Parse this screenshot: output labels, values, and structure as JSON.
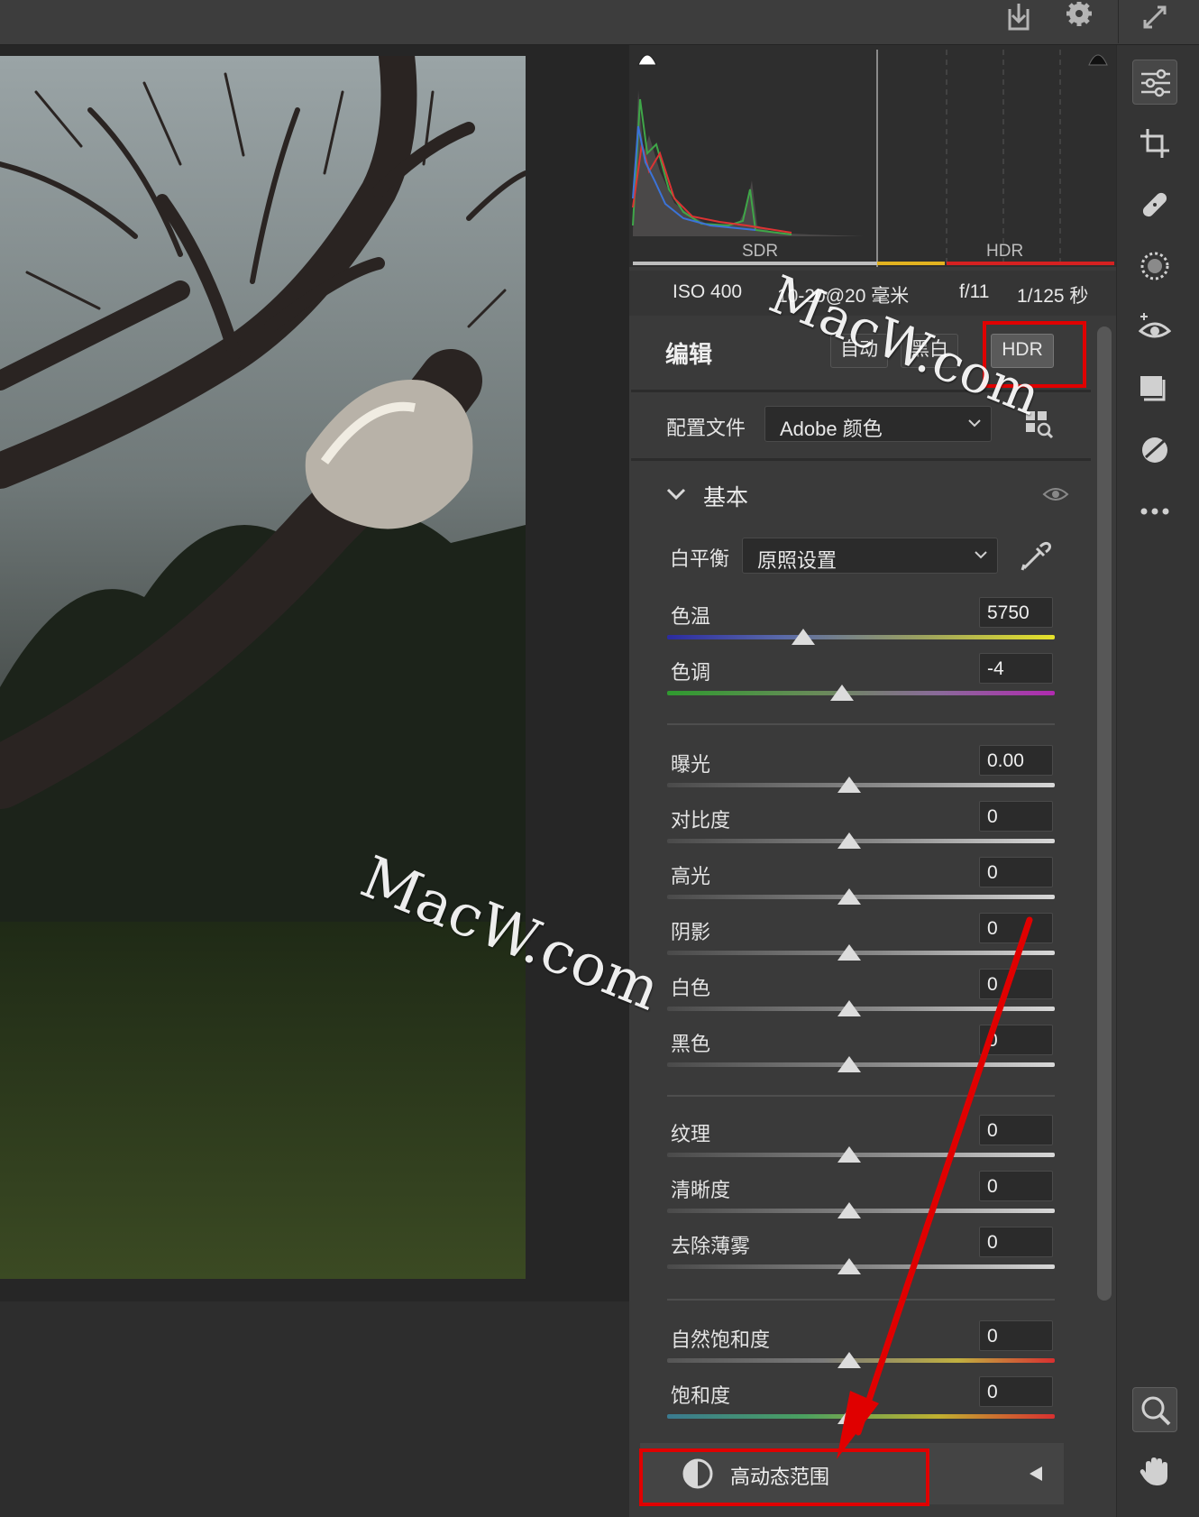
{
  "histogram": {
    "sdr_label": "SDR",
    "hdr_label": "HDR"
  },
  "meta": {
    "iso": "ISO 400",
    "lens": "10-20@20 毫米",
    "aperture": "f/11",
    "shutter": "1/125 秒"
  },
  "edit": {
    "title": "编辑",
    "auto_label": "自动",
    "bw_label": "黑白",
    "hdr_label": "HDR"
  },
  "profile": {
    "label": "配置文件",
    "value": "Adobe 颜色"
  },
  "basic": {
    "title": "基本",
    "white_balance": {
      "label": "白平衡",
      "value": "原照设置"
    },
    "temp": {
      "label": "色温",
      "value": "5750",
      "position": 0.35
    },
    "tint": {
      "label": "色调",
      "value": "-4",
      "position": 0.45
    },
    "tone": [
      {
        "label": "曝光",
        "value": "0.00",
        "position": 0.47
      },
      {
        "label": "对比度",
        "value": "0",
        "position": 0.47
      },
      {
        "label": "高光",
        "value": "0",
        "position": 0.47
      },
      {
        "label": "阴影",
        "value": "0",
        "position": 0.47
      },
      {
        "label": "白色",
        "value": "0",
        "position": 0.47
      },
      {
        "label": "黑色",
        "value": "0",
        "position": 0.47
      }
    ],
    "presence": [
      {
        "label": "纹理",
        "value": "0",
        "position": 0.47
      },
      {
        "label": "清晰度",
        "value": "0",
        "position": 0.47
      },
      {
        "label": "去除薄雾",
        "value": "0",
        "position": 0.47
      }
    ],
    "vibrance": {
      "label": "自然饱和度",
      "value": "0",
      "position": 0.47
    },
    "saturation": {
      "label": "饱和度",
      "value": "0",
      "position": 0.47
    }
  },
  "hdr_section": {
    "label": "高动态范围"
  },
  "watermark": {
    "text": "MacW.com"
  },
  "colors": {
    "accent_red": "#e00000",
    "panel_bg": "#3a3a3a",
    "toolbar_bg": "#343434"
  },
  "icons": [
    "export-icon",
    "gear-icon",
    "fullscreen-icon",
    "edit-sliders-icon",
    "crop-icon",
    "healing-icon",
    "masking-icon",
    "redeye-icon",
    "presets-icon",
    "snapshots-icon",
    "more-icon",
    "zoom-icon",
    "hand-icon"
  ]
}
